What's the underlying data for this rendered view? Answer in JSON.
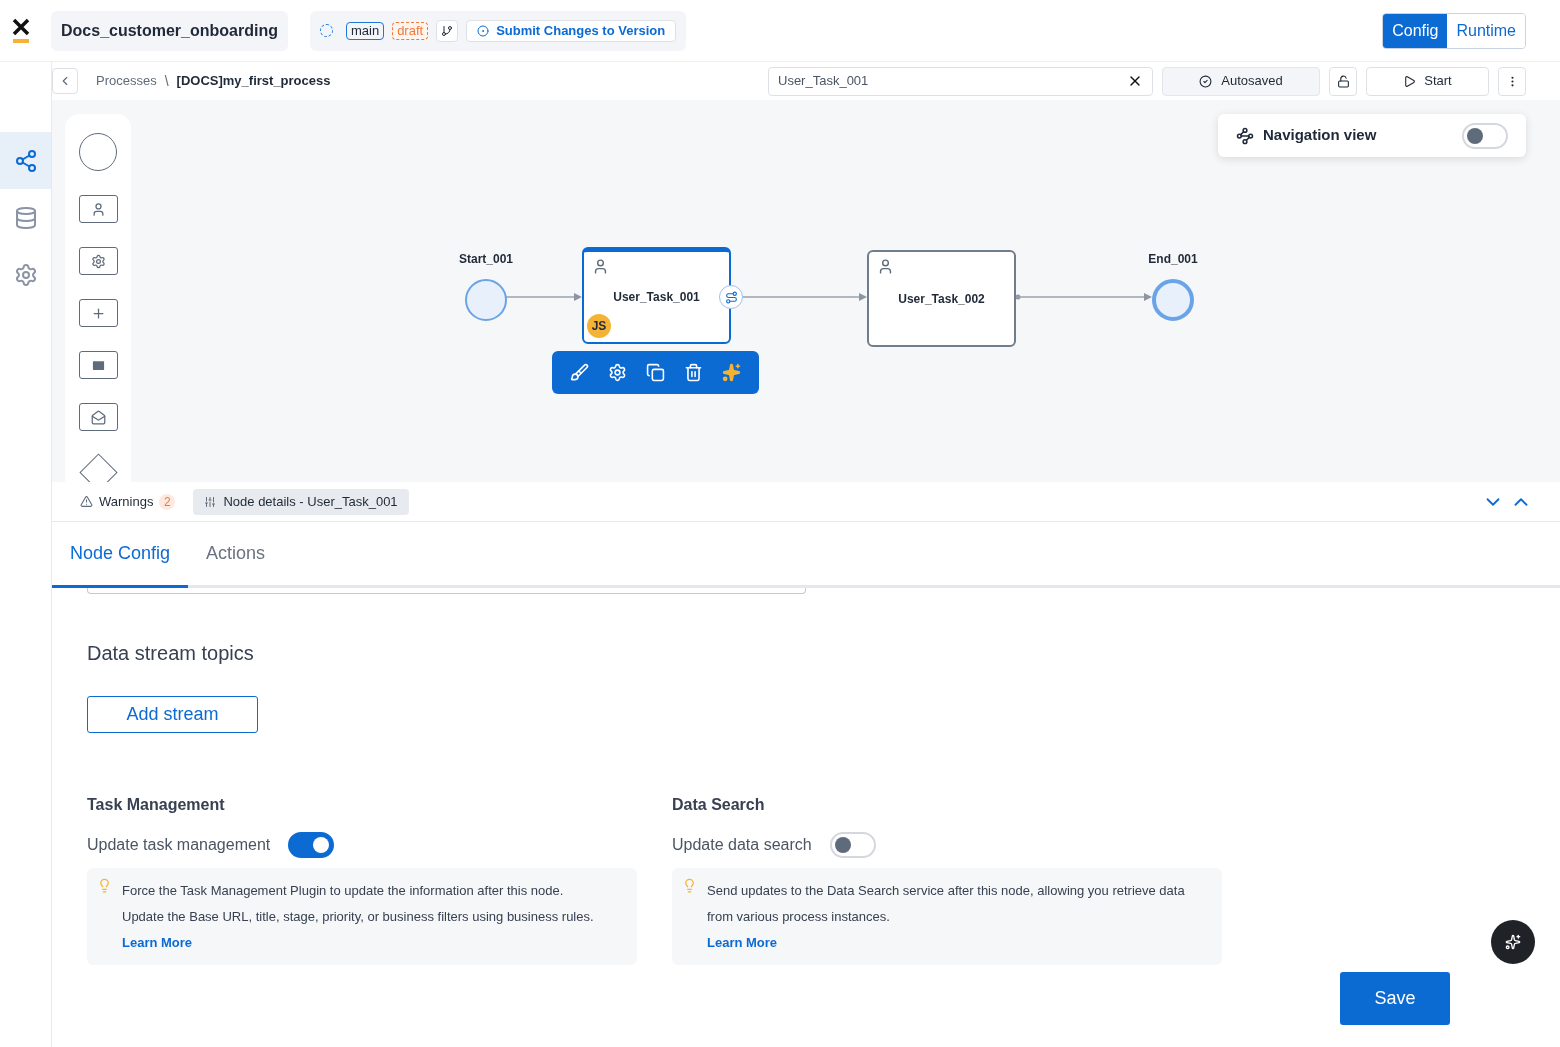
{
  "header": {
    "project_name": "Docs_customer_onboarding",
    "branch": "main",
    "status_badge": "draft",
    "submit_button": "Submit Changes to Version",
    "modes": [
      {
        "label": "Config",
        "selected": true
      },
      {
        "label": "Runtime",
        "selected": false
      }
    ]
  },
  "toolbar": {
    "breadcrumb": [
      "Processes",
      "\\",
      "[DOCS]my_first_process"
    ],
    "search": {
      "value": "User_Task_001"
    },
    "save_state": "Autosaved",
    "start_button": "Start"
  },
  "sidebar": {
    "items": [
      {
        "kind": "diagram",
        "selected": true
      },
      {
        "kind": "database",
        "selected": false
      },
      {
        "kind": "settings",
        "selected": false
      }
    ]
  },
  "navigation_view": {
    "label": "Navigation view",
    "on": false
  },
  "nodes": [
    {
      "kind": "start",
      "label": "Start_001"
    },
    {
      "kind": "task",
      "label": "User_Task_001",
      "selected": true,
      "badge": "JS"
    },
    {
      "kind": "task",
      "label": "User_Task_002",
      "selected": false
    },
    {
      "kind": "end",
      "label": "End_001"
    }
  ],
  "panel": {
    "warnings": {
      "label": "Warnings",
      "count": "2"
    },
    "node_details": "Node details - User_Task_001",
    "tabs": [
      {
        "label": "Node Config",
        "selected": true
      },
      {
        "label": "Actions",
        "selected": false
      }
    ],
    "section_title": "Data stream topics",
    "add_button": "Add stream",
    "settings": [
      {
        "title": "Task Management",
        "label": "Update task management",
        "on": true,
        "info": [
          "Force the Task Management Plugin to update the information after this node.",
          "Update the Base URL, title, stage, priority, or business filters using business rules."
        ],
        "link": "Learn More"
      },
      {
        "title": "Data Search",
        "label": "Update data search",
        "on": false,
        "info": [
          "Send updates to the Data Search service after this node, allowing you retrieve data from various process instances."
        ],
        "link": "Learn More"
      }
    ],
    "save_button": "Save"
  }
}
